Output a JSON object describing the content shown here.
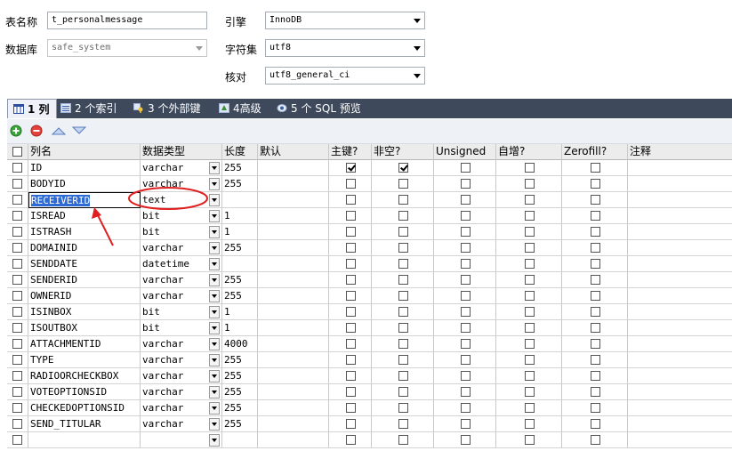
{
  "form": {
    "table_name_label": "表名称",
    "table_name_value": "t_personalmessage",
    "database_label": "数据库",
    "database_value": "safe_system",
    "engine_label": "引擎",
    "engine_value": "InnoDB",
    "charset_label": "字符集",
    "charset_value": "utf8",
    "collation_label": "核对",
    "collation_value": "utf8_general_ci"
  },
  "tabs": [
    {
      "label": "1 列",
      "icon": "columns-icon",
      "active": true
    },
    {
      "label": "2 个索引",
      "icon": "index-icon",
      "active": false
    },
    {
      "label": "3 个外部键",
      "icon": "foreign-key-icon",
      "active": false
    },
    {
      "label": "4高级",
      "icon": "advanced-icon",
      "active": false
    },
    {
      "label": "5 个 SQL 预览",
      "icon": "sql-preview-icon",
      "active": false
    }
  ],
  "toolbar": {
    "add": "add-icon",
    "remove": "remove-icon",
    "up": "move-up-icon",
    "down": "move-down-icon"
  },
  "columns": {
    "name": "列名",
    "type": "数据类型",
    "length": "长度",
    "default": "默认",
    "pk": "主键?",
    "not_null": "非空?",
    "unsigned": "Unsigned",
    "auto_inc": "自增?",
    "zerofill": "Zerofill?",
    "comment": "注释"
  },
  "rows": [
    {
      "name": "ID",
      "type": "varchar",
      "length": "255",
      "pk": true,
      "nn": true
    },
    {
      "name": "BODYID",
      "type": "varchar",
      "length": "255",
      "pk": false,
      "nn": false
    },
    {
      "name": "RECEIVERID",
      "type": "text",
      "length": "",
      "pk": false,
      "nn": false
    },
    {
      "name": "ISREAD",
      "type": "bit",
      "length": "1",
      "pk": false,
      "nn": false
    },
    {
      "name": "ISTRASH",
      "type": "bit",
      "length": "1",
      "pk": false,
      "nn": false
    },
    {
      "name": "DOMAINID",
      "type": "varchar",
      "length": "255",
      "pk": false,
      "nn": false
    },
    {
      "name": "SENDDATE",
      "type": "datetime",
      "length": "",
      "pk": false,
      "nn": false
    },
    {
      "name": "SENDERID",
      "type": "varchar",
      "length": "255",
      "pk": false,
      "nn": false
    },
    {
      "name": "OWNERID",
      "type": "varchar",
      "length": "255",
      "pk": false,
      "nn": false
    },
    {
      "name": "ISINBOX",
      "type": "bit",
      "length": "1",
      "pk": false,
      "nn": false
    },
    {
      "name": "ISOUTBOX",
      "type": "bit",
      "length": "1",
      "pk": false,
      "nn": false
    },
    {
      "name": "ATTACHMENTID",
      "type": "varchar",
      "length": "4000",
      "pk": false,
      "nn": false
    },
    {
      "name": "TYPE",
      "type": "varchar",
      "length": "255",
      "pk": false,
      "nn": false
    },
    {
      "name": "RADIOORCHECKBOX",
      "type": "varchar",
      "length": "255",
      "pk": false,
      "nn": false
    },
    {
      "name": "VOTEOPTIONSID",
      "type": "varchar",
      "length": "255",
      "pk": false,
      "nn": false
    },
    {
      "name": "CHECKEDOPTIONSID",
      "type": "varchar",
      "length": "255",
      "pk": false,
      "nn": false
    },
    {
      "name": "SEND_TITULAR",
      "type": "varchar",
      "length": "255",
      "pk": false,
      "nn": false
    },
    {
      "name": "",
      "type": "",
      "length": "",
      "pk": false,
      "nn": false
    }
  ],
  "selected_row": 2,
  "colors": {
    "tabbar": "#3e4a5c",
    "selection": "#2d6ad4",
    "annotation": "#e02020"
  }
}
